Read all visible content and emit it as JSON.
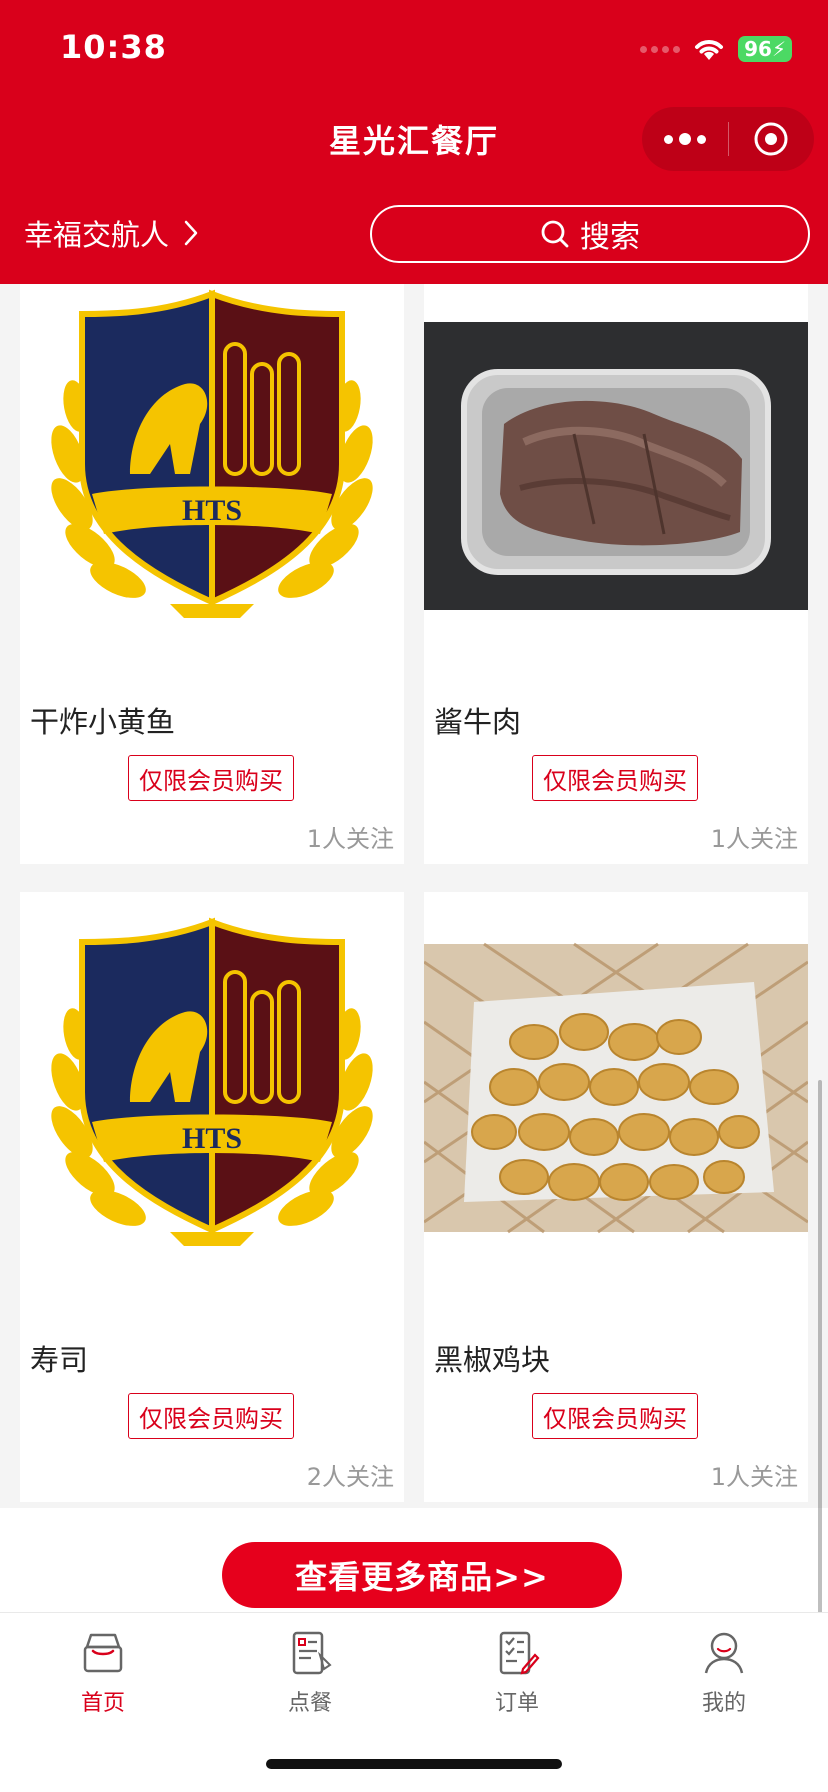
{
  "status_bar": {
    "time": "10:38",
    "battery": "96"
  },
  "header": {
    "title": "星光汇餐厅",
    "store_name": "幸福交航人",
    "search_label": "搜索"
  },
  "products": [
    {
      "name": "干炸小黄鱼",
      "tag": "仅限会员购买",
      "followers": "1人关注",
      "image": "HTS crest logo"
    },
    {
      "name": "酱牛肉",
      "tag": "仅限会员购买",
      "followers": "1人关注",
      "image": "sliced braised beef in foil tray"
    },
    {
      "name": "寿司",
      "tag": "仅限会员购买",
      "followers": "2人关注",
      "image": "HTS crest logo"
    },
    {
      "name": "黑椒鸡块",
      "tag": "仅限会员购买",
      "followers": "1人关注",
      "image": "fried chicken nuggets in basket"
    }
  ],
  "more_button": "查看更多商品>>",
  "tabs": [
    {
      "label": "首页",
      "icon": "store-icon",
      "active": true
    },
    {
      "label": "点餐",
      "icon": "menu-order-icon",
      "active": false
    },
    {
      "label": "订单",
      "icon": "order-list-icon",
      "active": false
    },
    {
      "label": "我的",
      "icon": "user-icon",
      "active": false
    }
  ],
  "colors": {
    "brand_red": "#d9001b",
    "button_red": "#e6001c",
    "battery_green": "#4cd964"
  }
}
